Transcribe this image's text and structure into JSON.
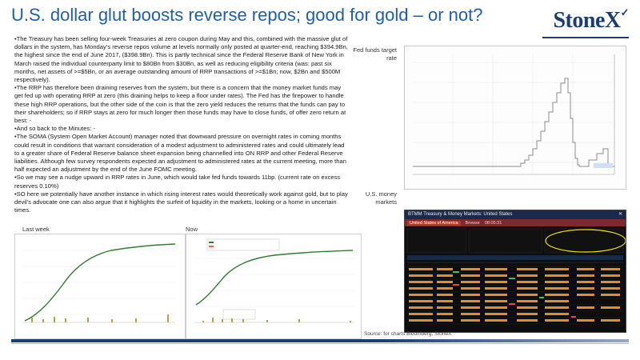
{
  "title": "U.S. dollar glut boosts reverse repos; good for gold – or not?",
  "logo": "StoneX",
  "paragraphs": [
    "•The Treasury has been selling four-week Treasuries at zero coupon during May and this, combined with the massive glut of dollars in the system, has Monday’s reverse repos volume at levels normally only posted at quarter-end, reaching $394.9Bn, the highest since the end of June 2017, ($398.9Bn). This is partly technical since the Federal Reserve Bank of New York in March raised the individual counterparty limit to $80Bn from $30Bn, as well as reducing eligibility criteria (was: past six months, net assets of >=$5Bn, or an average outstanding amount of RRP transactions of >=$1Bn; now, $2Bn and $500M respectively).",
    "•The RRP has therefore been draining reserves from the system, but there is a concern that the money market funds may get fed up with operating RRP at zero (this draining helps to keep a floor under rates). The Fed has the firepower to handle these high RRP operations, but the other side of the coin is that the zero yield reduces the returns that the funds can pay to their shareholders; so if RRP stays at zero for much longer then those funds may have to close funds, of offer zero return at best: -",
    "•And so back to the Minutes: -",
    "•The SOMA (System Open Market Account) manager noted that downward pressure on overnight rates in coming months could result in conditions that warrant consideration of a modest adjustment to administered rates and could ultimately lead to a greater share of Federal Reserve balance sheet expansion being channelled into ON RRP and other Federal Reserve liabilities. Although few survey respondents expected an adjustment to administered rates at the current meeting, more than half expected an adjustment by the end of the June FOMC meeting.",
    "•So we may see a nudge upward in RRP rates in June, which would take fed funds towards 11bp. (current rate on excess reserves 0.10%)",
    "•SO here we potentially have another instance in which rising interest rates would theoretically work against gold, but to play devil’s advocate one can also argue that it highlights the surfeit of liquidity in the markets, looking or a home in uncertain times."
  ],
  "labels": {
    "fed_funds": "Fed funds target rate",
    "money_markets": "U.S. money markets",
    "last_week": "Last week",
    "now": "Now"
  },
  "bloomberg": {
    "header": "BTMM Treasury & Money Markets: United States",
    "region": "United States of America",
    "browse": "Browse",
    "time": "08:05:31"
  },
  "source": "Source: for charts Bloomberg, StoneX",
  "colors": {
    "title_blue": "#1f5fa8",
    "logo_navy": "#1b3e73",
    "step_line": "#8a8a8a",
    "curve_green": "#2e7d32",
    "bar_olive": "#b5a14a"
  }
}
